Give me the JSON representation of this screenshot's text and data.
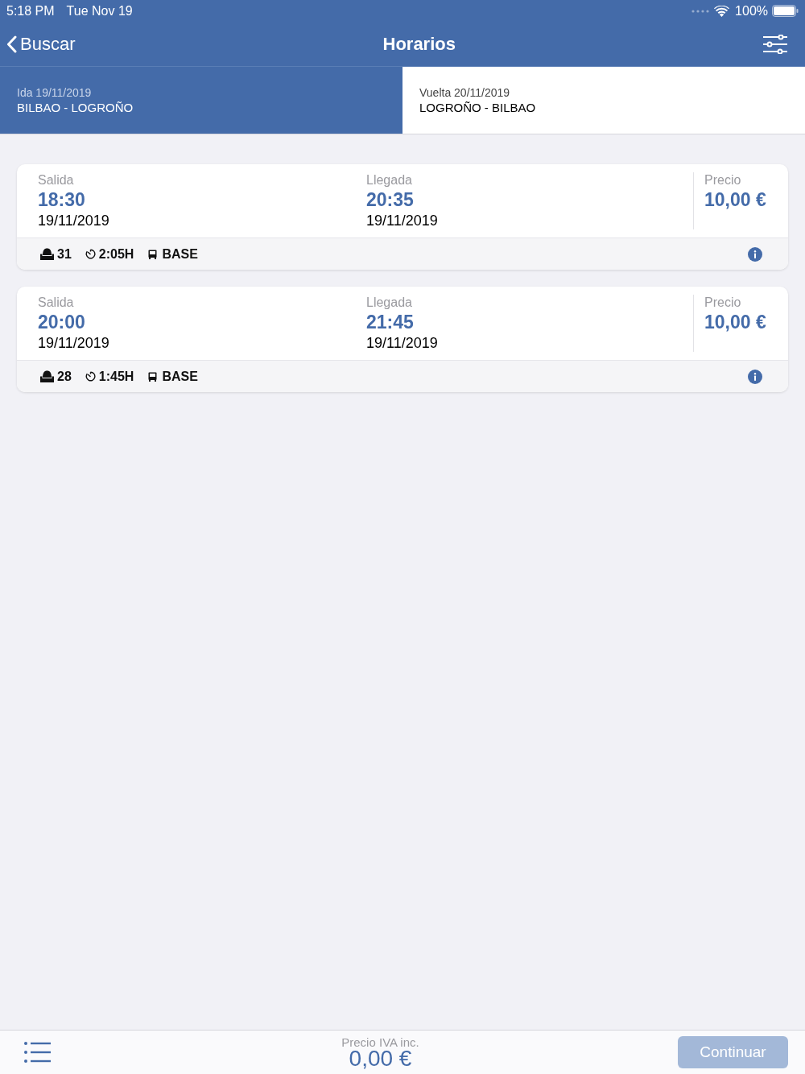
{
  "status_bar": {
    "time": "5:18 PM",
    "date": "Tue Nov 19",
    "battery": "100%"
  },
  "nav_bar": {
    "back": "Buscar",
    "title": "Horarios"
  },
  "tabs": [
    {
      "label": "Ida 19/11/2019",
      "route": "BILBAO - LOGROÑO",
      "selected": true
    },
    {
      "label": "Vuelta 20/11/2019",
      "route": "LOGROÑO - BILBAO",
      "selected": false
    }
  ],
  "trips": [
    {
      "departure": {
        "label": "Salida",
        "time": "18:30",
        "date": "19/11/2019"
      },
      "arrival": {
        "label": "Llegada",
        "time": "20:35",
        "date": "19/11/2019"
      },
      "price": {
        "label": "Precio",
        "amount": "10,00 €"
      },
      "seats": "31",
      "duration": "2:05H",
      "fare": "BASE"
    },
    {
      "departure": {
        "label": "Salida",
        "time": "20:00",
        "date": "19/11/2019"
      },
      "arrival": {
        "label": "Llegada",
        "time": "21:45",
        "date": "19/11/2019"
      },
      "price": {
        "label": "Precio",
        "amount": "10,00 €"
      },
      "seats": "28",
      "duration": "1:45H",
      "fare": "BASE"
    }
  ],
  "footer": {
    "total_label": "Precio IVA inc.",
    "total": "0,00 €",
    "continue_button": {
      "label": "Continuar",
      "disabled": true
    }
  }
}
